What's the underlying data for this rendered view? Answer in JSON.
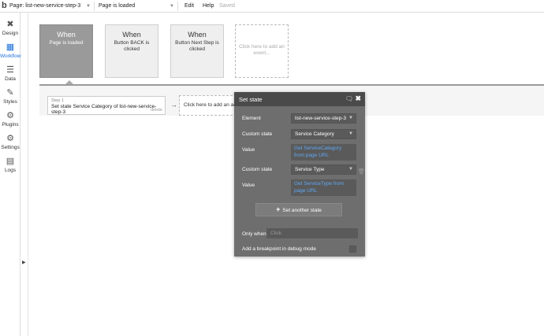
{
  "topbar": {
    "logo": "b",
    "page_label": "Page: list-new-service-step-3",
    "event_label": "Page is loaded",
    "edit": "Edit",
    "help": "Help",
    "saved": "Saved"
  },
  "sidebar": {
    "items": [
      {
        "label": "Design",
        "icon": "design-icon"
      },
      {
        "label": "Workflow",
        "icon": "workflow-icon"
      },
      {
        "label": "Data",
        "icon": "database-icon"
      },
      {
        "label": "Styles",
        "icon": "brush-icon"
      },
      {
        "label": "Plugins",
        "icon": "plug-icon"
      },
      {
        "label": "Settings",
        "icon": "gear-icon"
      },
      {
        "label": "Logs",
        "icon": "document-icon"
      }
    ]
  },
  "events": [
    {
      "when": "When",
      "desc": "Page is loaded"
    },
    {
      "when": "When",
      "desc": "Button BACK is clicked"
    },
    {
      "when": "When",
      "desc": "Button Next Step is clicked"
    },
    {
      "desc": "Click here to add an event..."
    }
  ],
  "step": {
    "num": "Step 1",
    "title": "Set state Service Category of list-new-service-step-3",
    "delete": "delete",
    "add_action": "Click here to add an action..."
  },
  "modal": {
    "title": "Set state",
    "element_label": "Element",
    "element_value": "list-new-service-step-3",
    "state1_label": "Custom state",
    "state1_value": "Service Category",
    "value1_label": "Value",
    "value1_expr": "Get ServiceCategory from page URL",
    "state2_label": "Custom state",
    "state2_value": "Service Type",
    "value2_label": "Value",
    "value2_expr": "Get ServiceType from page URL",
    "set_another": "Set another state",
    "only_when_label": "Only when",
    "only_when_placeholder": "Click",
    "breakpoint_label": "Add a breakpoint in debug mode"
  },
  "colors": {
    "accent": "#1d6fd8",
    "expression": "#5fa8f5",
    "modal_bg": "#6e6e6e"
  }
}
